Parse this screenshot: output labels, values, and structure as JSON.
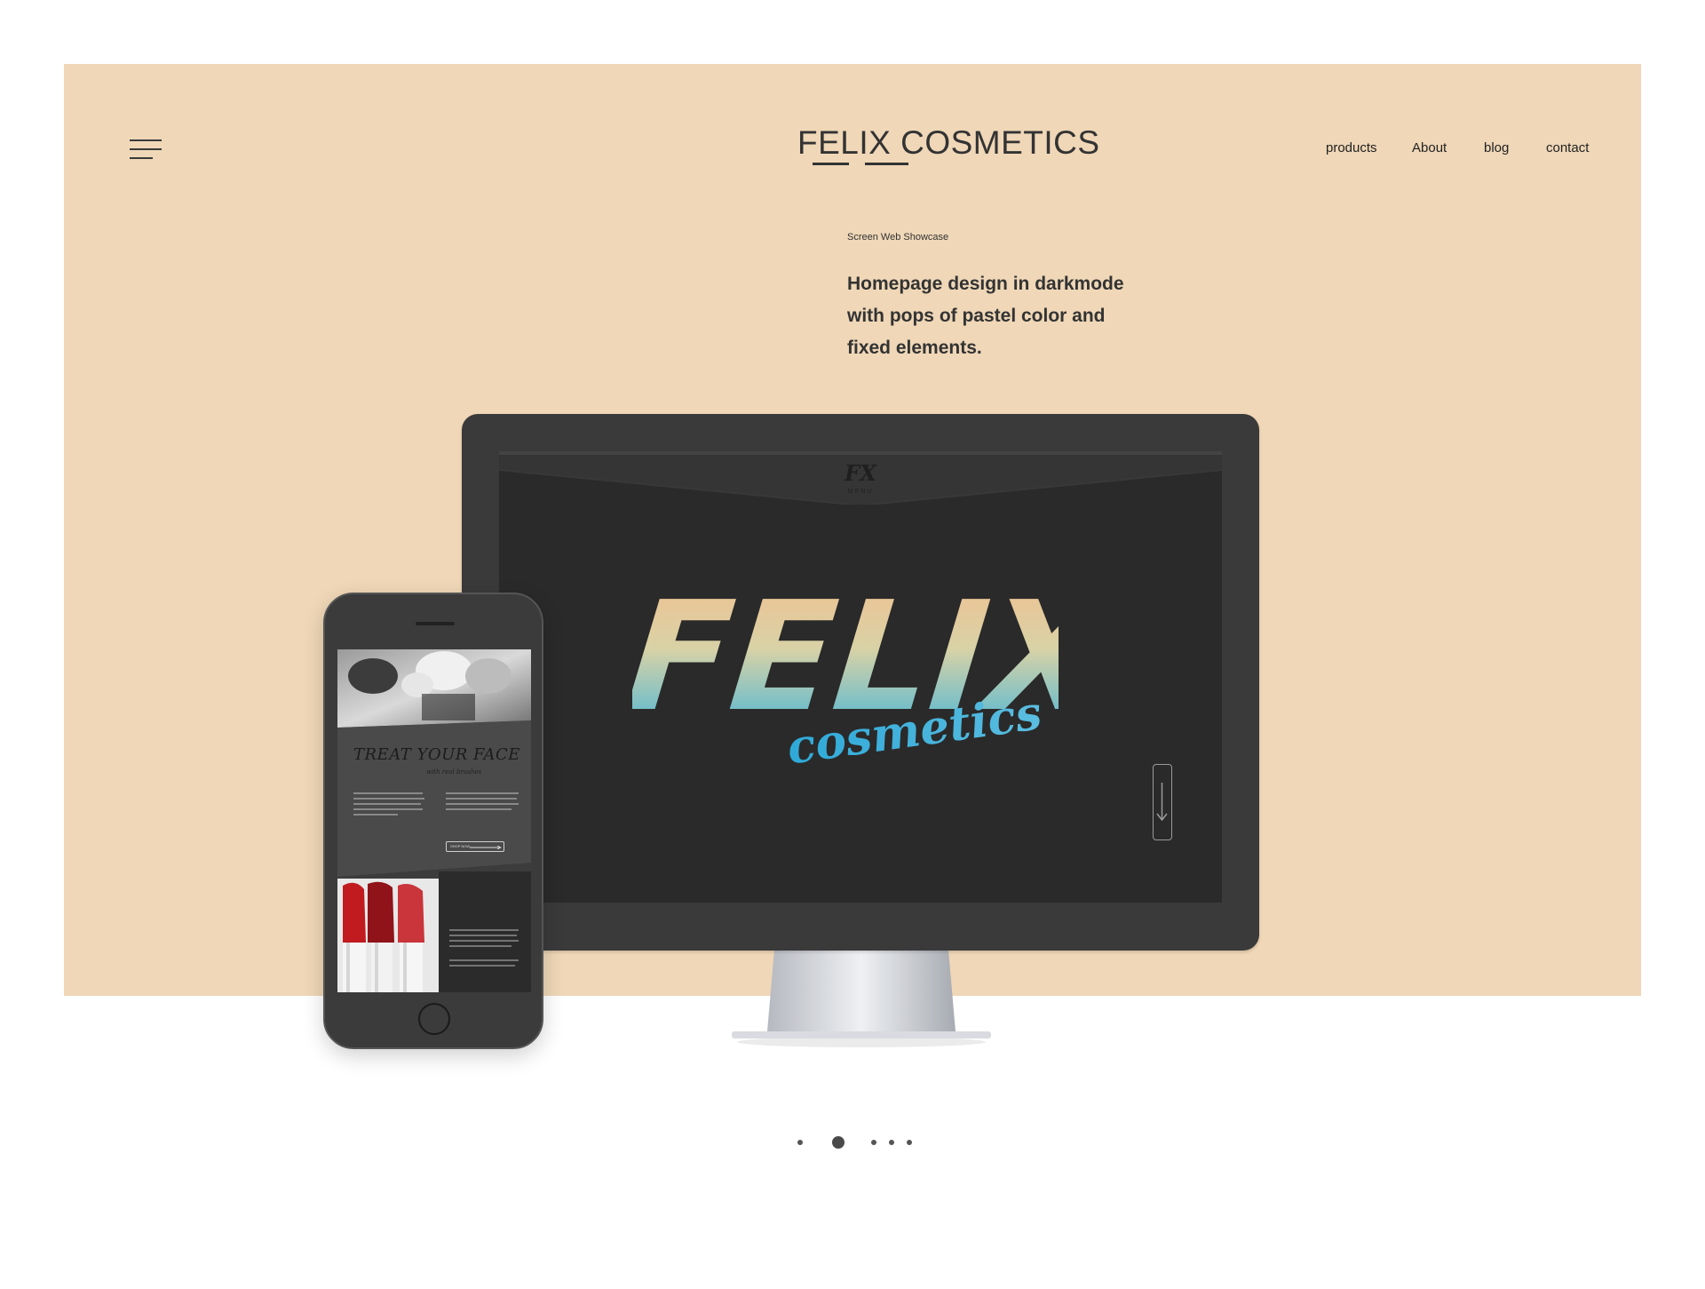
{
  "header": {
    "brand": "FELIX COSMETICS",
    "nav": [
      "products",
      "About",
      "blog",
      "contact"
    ]
  },
  "hero": {
    "eyebrow": "Screen Web Showcase",
    "headline_lines": [
      "Homepage design in darkmode",
      "with pops of pastel color and",
      "fixed elements."
    ]
  },
  "monitor_screen": {
    "logo_main": "FELIX",
    "logo_sub": "cosmetics",
    "monogram": "FX",
    "menu_label": "MENU"
  },
  "phone_screen": {
    "heading": "TREAT YOUR FACE",
    "subheading": "with real brushes",
    "cta": "SHOP NOW"
  },
  "pagination": {
    "count": 5,
    "active": 1
  },
  "colors": {
    "panel": "#efd7b7",
    "dark": "#2a2a2a",
    "gradient_top": "#f0c08e",
    "gradient_bottom": "#3ab3dd"
  }
}
